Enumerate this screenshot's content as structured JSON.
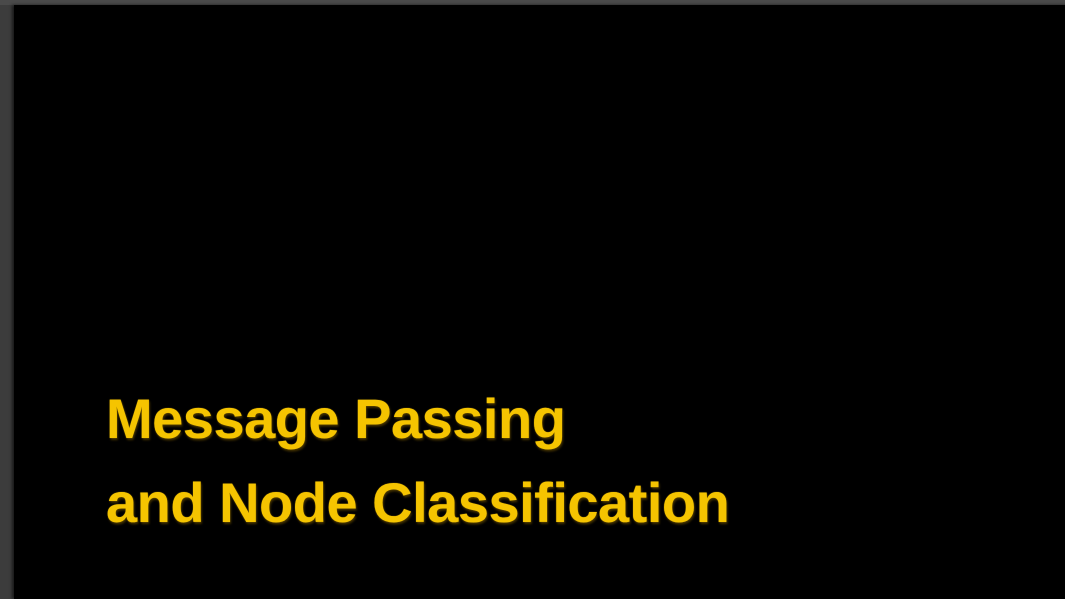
{
  "slide": {
    "title_lines": [
      "Message Passing",
      "and Node Classification"
    ]
  },
  "colors": {
    "slide_background": "#000000",
    "title_text": "#f5c400",
    "viewer_frame": "#3c3c3c"
  }
}
